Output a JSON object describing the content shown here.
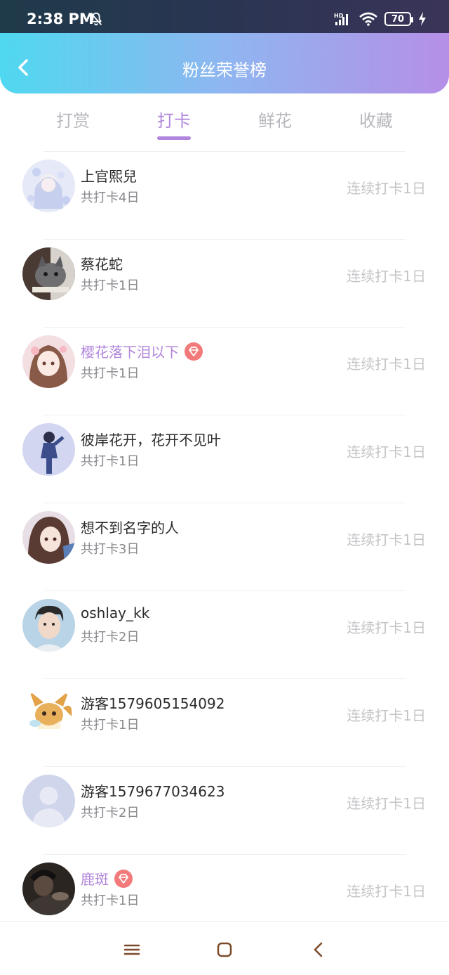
{
  "status": {
    "time": "2:38 PM",
    "battery": "70",
    "hd": "HD"
  },
  "header": {
    "title": "粉丝荣誉榜"
  },
  "tabs": [
    {
      "label": "打赏",
      "active": false
    },
    {
      "label": "打卡",
      "active": true
    },
    {
      "label": "鲜花",
      "active": false
    },
    {
      "label": "收藏",
      "active": false
    }
  ],
  "rows": [
    {
      "name": "上官熙兒",
      "sub": "共打卡4日",
      "streak": "连续打卡1日",
      "vip": false,
      "avatar": "girl-illustration"
    },
    {
      "name": "蔡花蛇",
      "sub": "共打卡1日",
      "streak": "连续打卡1日",
      "vip": false,
      "avatar": "cat-photo"
    },
    {
      "name": "樱花落下泪以下",
      "sub": "共打卡1日",
      "streak": "连续打卡1日",
      "vip": true,
      "avatar": "anime-girl"
    },
    {
      "name": "彼岸花开，花开不见叶",
      "sub": "共打卡1日",
      "streak": "连续打卡1日",
      "vip": false,
      "avatar": "anime-boy"
    },
    {
      "name": "想不到名字的人",
      "sub": "共打卡3日",
      "streak": "连续打卡1日",
      "vip": false,
      "avatar": "anime-girl-hair"
    },
    {
      "name": "oshlay_kk",
      "sub": "共打卡2日",
      "streak": "连续打卡1日",
      "vip": false,
      "avatar": "man-photo"
    },
    {
      "name": "游客1579605154092",
      "sub": "共打卡1日",
      "streak": "连续打卡1日",
      "vip": false,
      "avatar": "eevee"
    },
    {
      "name": "游客1579677034623",
      "sub": "共打卡2日",
      "streak": "连续打卡1日",
      "vip": false,
      "avatar": "default-user"
    },
    {
      "name": "鹿斑",
      "sub": "共打卡1日",
      "streak": "连续打卡1日",
      "vip": true,
      "avatar": "dark-photo"
    }
  ],
  "colors": {
    "accent": "#b286dc",
    "vip_gem": "#f27a7a"
  }
}
